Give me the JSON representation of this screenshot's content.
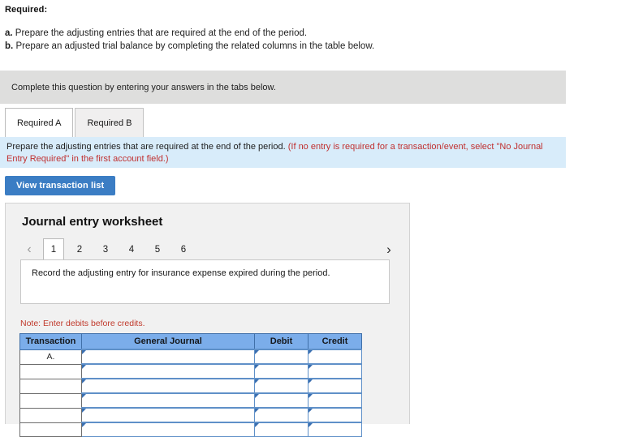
{
  "required": {
    "heading": "Required:",
    "items": [
      {
        "label": "a.",
        "text": "Prepare the adjusting entries that are required at the end of the period."
      },
      {
        "label": "b.",
        "text": "Prepare an adjusted trial balance by completing the related columns in the table below."
      }
    ]
  },
  "instruction_bar": {
    "text": "Complete this question by entering your answers in the tabs below."
  },
  "tabs": [
    {
      "label": "Required A",
      "active": true
    },
    {
      "label": "Required B",
      "active": false
    }
  ],
  "blue_band": {
    "text_main": "Prepare the adjusting entries that are required at the end of the period.",
    "text_red": "(If no entry is required for a transaction/event, select \"No Journal Entry Required\" in the first account field.)"
  },
  "toolbar": {
    "view_transaction_list_label": "View transaction list"
  },
  "worksheet": {
    "title": "Journal entry worksheet",
    "pager": {
      "prev_icon": "chevron-left-icon",
      "next_icon": "chevron-right-icon",
      "pages": [
        "1",
        "2",
        "3",
        "4",
        "5",
        "6"
      ],
      "active_page": "1"
    },
    "prompt": "Record the adjusting entry for insurance expense expired during the period.",
    "note": "Note: Enter debits before credits.",
    "table": {
      "headers": [
        "Transaction",
        "General Journal",
        "Debit",
        "Credit"
      ],
      "rows": [
        {
          "transaction": "A.",
          "general_journal": "",
          "debit": "",
          "credit": ""
        },
        {
          "transaction": "",
          "general_journal": "",
          "debit": "",
          "credit": ""
        },
        {
          "transaction": "",
          "general_journal": "",
          "debit": "",
          "credit": ""
        },
        {
          "transaction": "",
          "general_journal": "",
          "debit": "",
          "credit": ""
        },
        {
          "transaction": "",
          "general_journal": "",
          "debit": "",
          "credit": ""
        },
        {
          "transaction": "",
          "general_journal": "",
          "debit": "",
          "credit": ""
        }
      ]
    }
  },
  "colors": {
    "accent_blue": "#3b7dc4",
    "table_header_blue": "#7badea",
    "band_blue": "#d8ecfa",
    "bar_gray": "#dededd",
    "note_red": "#c0392b"
  }
}
